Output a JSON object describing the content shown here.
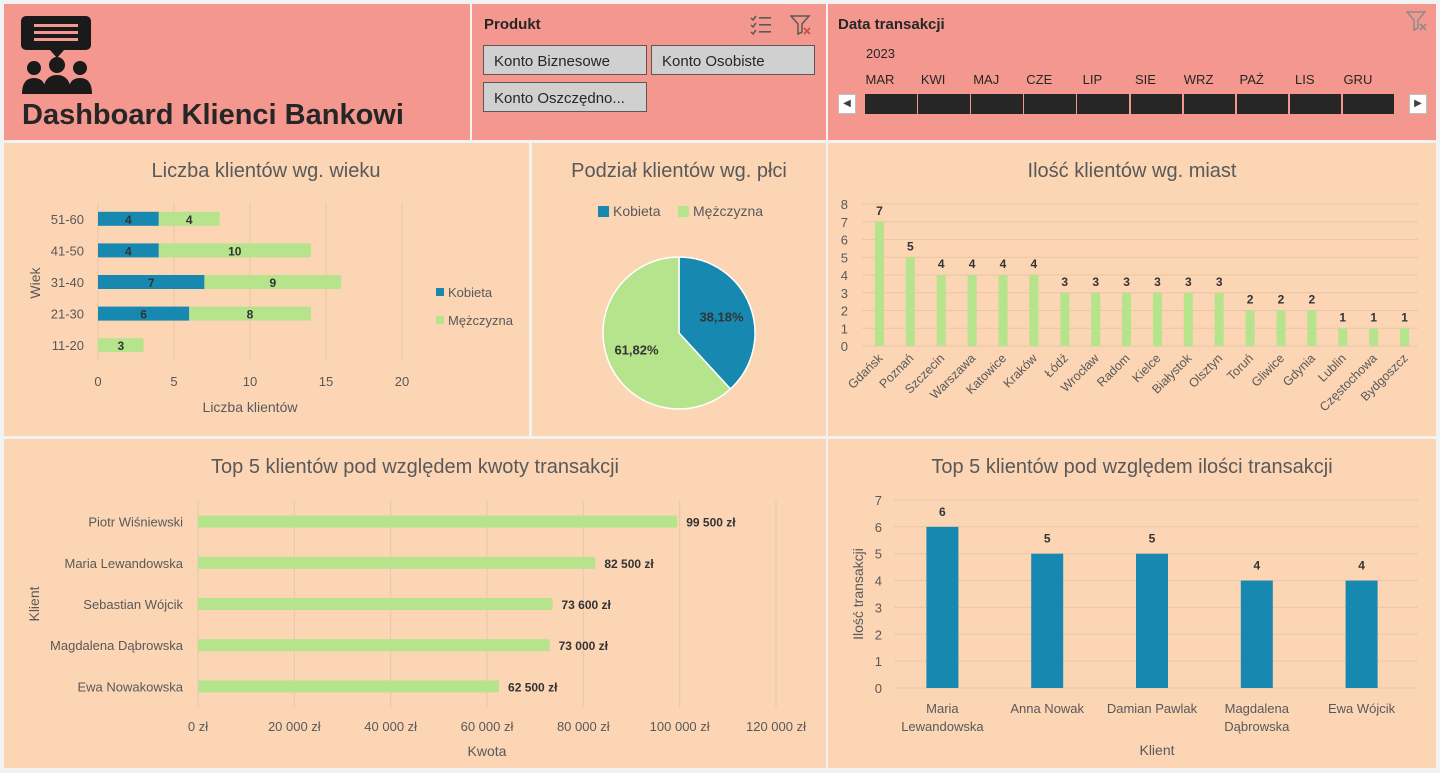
{
  "dashboard": {
    "title": "Dashboard Klienci Bankowi"
  },
  "icons": {
    "header": "group-chat-icon",
    "multiselect": "multi-select-icon",
    "clear_filter": "clear-filter-icon"
  },
  "colors": {
    "salmon": "#f4978e",
    "peach": "#fcd5b5",
    "kobieta": "#1789b0",
    "mezczyzna": "#b5e48c"
  },
  "product_slicer": {
    "title": "Produkt",
    "items": [
      "Konto Biznesowe",
      "Konto Osobiste",
      "Konto Oszczędno..."
    ]
  },
  "date_timeline": {
    "title": "Data transakcji",
    "year": "2023",
    "months": [
      "MAR",
      "KWI",
      "MAJ",
      "CZE",
      "LIP",
      "SIE",
      "WRZ",
      "PAŹ",
      "LIS",
      "GRU"
    ]
  },
  "chart_data": [
    {
      "id": "age",
      "type": "bar",
      "orientation": "horizontal",
      "stacked": true,
      "title": "Liczba klientów wg. wieku",
      "xlabel": "Liczba klientów",
      "ylabel": "Wiek",
      "categories": [
        "51-60",
        "41-50",
        "31-40",
        "21-30",
        "11-20"
      ],
      "series": [
        {
          "name": "Kobieta",
          "values": [
            4,
            4,
            7,
            6,
            0
          ]
        },
        {
          "name": "Mężczyzna",
          "values": [
            4,
            10,
            9,
            8,
            3
          ]
        }
      ],
      "xlim": [
        0,
        20
      ],
      "xticks": [
        "0",
        "5",
        "10",
        "15",
        "20"
      ],
      "grid": true,
      "legend": "right"
    },
    {
      "id": "gender",
      "type": "pie",
      "title": "Podział klientów wg. płci",
      "slices": [
        {
          "name": "Kobieta",
          "value": 38.18,
          "label": "38,18%"
        },
        {
          "name": "Mężczyzna",
          "value": 61.82,
          "label": "61,82%"
        }
      ],
      "legend": "top"
    },
    {
      "id": "cities",
      "type": "bar",
      "title": "Ilość klientów wg. miast",
      "categories": [
        "Gdańsk",
        "Poznań",
        "Szczecin",
        "Warszawa",
        "Katowice",
        "Kraków",
        "Łódź",
        "Wrocław",
        "Radom",
        "Kielce",
        "Białystok",
        "Olsztyn",
        "Toruń",
        "Gliwice",
        "Gdynia",
        "Lublin",
        "Częstochowa",
        "Bydgoszcz"
      ],
      "values": [
        7,
        5,
        4,
        4,
        4,
        4,
        3,
        3,
        3,
        3,
        3,
        3,
        2,
        2,
        2,
        1,
        1,
        1
      ],
      "ylim": [
        0,
        8
      ],
      "yticks": [
        "0",
        "1",
        "2",
        "3",
        "4",
        "5",
        "6",
        "7",
        "8"
      ],
      "grid": true
    },
    {
      "id": "top_amount",
      "type": "bar",
      "orientation": "horizontal",
      "title": "Top 5 klientów pod względem kwoty transakcji",
      "xlabel": "Kwota",
      "ylabel": "Klient",
      "categories": [
        "Piotr Wiśniewski",
        "Maria Lewandowska",
        "Sebastian Wójcik",
        "Magdalena Dąbrowska",
        "Ewa Nowakowska"
      ],
      "values": [
        99500,
        82500,
        73600,
        73000,
        62500
      ],
      "data_labels": [
        "99 500 zł",
        "82 500 zł",
        "73 600 zł",
        "73 000 zł",
        "62 500 zł"
      ],
      "xlim": [
        0,
        120000
      ],
      "xticks": [
        "0 zł",
        "20 000 zł",
        "40 000 zł",
        "60 000 zł",
        "80 000 zł",
        "100 000 zł",
        "120 000 zł"
      ],
      "grid": true
    },
    {
      "id": "top_count",
      "type": "bar",
      "title": "Top 5 klientów pod względem ilości transakcji",
      "xlabel": "Klient",
      "ylabel": "Ilość transakcji",
      "categories": [
        "Maria Lewandowska",
        "Anna Nowak",
        "Damian Pawlak",
        "Magdalena Dąbrowska",
        "Ewa Wójcik"
      ],
      "values": [
        6,
        5,
        5,
        4,
        4
      ],
      "ylim": [
        0,
        7
      ],
      "yticks": [
        "0",
        "1",
        "2",
        "3",
        "4",
        "5",
        "6",
        "7"
      ],
      "grid": true
    }
  ]
}
